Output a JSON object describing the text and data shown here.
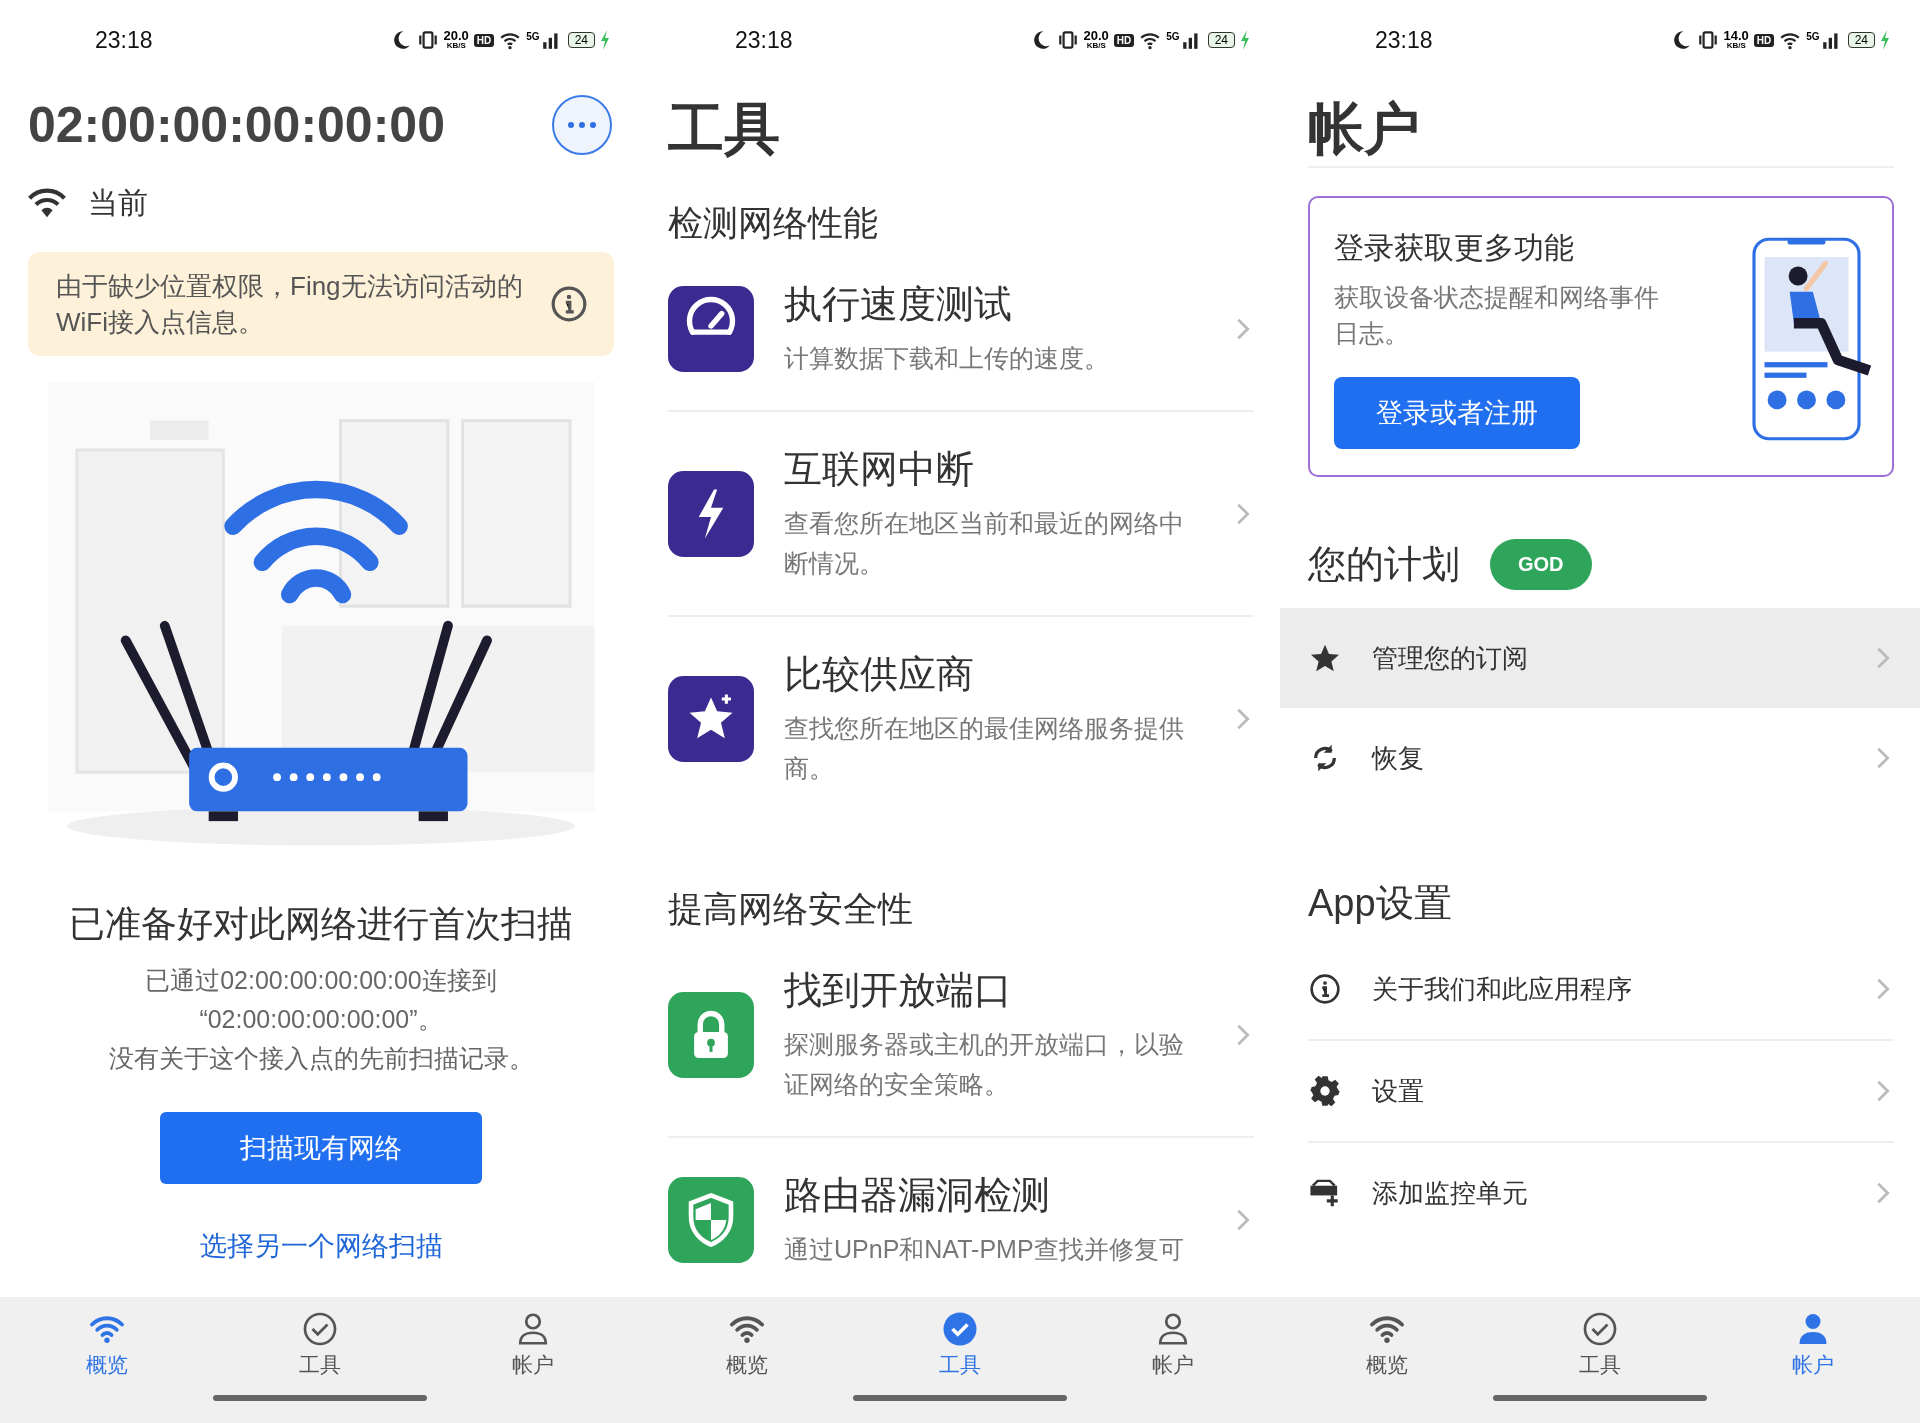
{
  "screens": [
    {
      "kind": "overview",
      "status_bar": {
        "time": "23:18",
        "speed": "20.0",
        "speed_unit": "KB/S",
        "hd": "HD",
        "network": "5G",
        "battery": "24"
      },
      "network_name": "02:00:00:00:00:00",
      "current_label": "当前",
      "warning": "由于缺少位置权限，Fing无法访问活动的WiFi接入点信息。",
      "heading": "已准备好对此网络进行首次扫描",
      "description": [
        "已通过02:00:00:00:00:00连接到",
        "“02:00:00:00:00:00”。",
        "没有关于这个接入点的先前扫描记录。"
      ],
      "scan_button": "扫描现有网络",
      "other_link": "选择另一个网络扫描",
      "tab_bar": [
        {
          "label": "概览",
          "kind": "wifi",
          "selected": true
        },
        {
          "label": "工具",
          "kind": "check",
          "selected": false
        },
        {
          "label": "帐户",
          "kind": "person",
          "selected": false
        }
      ]
    },
    {
      "kind": "tools",
      "status_bar": {
        "time": "23:18",
        "speed": "20.0",
        "speed_unit": "KB/S",
        "hd": "HD",
        "network": "5G",
        "battery": "24"
      },
      "title": "工具",
      "sections": [
        {
          "title": "检测网络性能",
          "items": [
            {
              "title": "执行速度测试",
              "description": "计算数据下载和上传的速度。",
              "kind": "gauge",
              "color": "#3b2a8f"
            },
            {
              "title": "互联网中断",
              "description": "查看您所在地区当前和最近的网络中断情况。",
              "kind": "bolt",
              "color": "#3b2a8f"
            },
            {
              "title": "比较供应商",
              "description": "查找您所在地区的最佳网络服务提供商。",
              "kind": "star",
              "color": "#3b2a8f"
            }
          ]
        },
        {
          "title": "提高网络安全性",
          "items": [
            {
              "title": "找到开放端口",
              "description": "探测服务器或主机的开放端口，以验证网络的安全策略。",
              "kind": "lock",
              "color": "#2fa55c"
            },
            {
              "title": "路由器漏洞检测",
              "description": "通过UPnP和NAT-PMP查找并修复可",
              "kind": "shield",
              "color": "#2fa55c"
            }
          ]
        }
      ],
      "tab_bar": [
        {
          "label": "概览",
          "kind": "wifi",
          "selected": false
        },
        {
          "label": "工具",
          "kind": "check",
          "selected": true
        },
        {
          "label": "帐户",
          "kind": "person",
          "selected": false
        }
      ]
    },
    {
      "kind": "account",
      "status_bar": {
        "time": "23:18",
        "speed": "14.0",
        "speed_unit": "KB/S",
        "hd": "HD",
        "network": "5G",
        "battery": "24"
      },
      "title": "帐户",
      "login_card": {
        "title": "登录获取更多功能",
        "description": "获取设备状态提醒和网络事件日志。",
        "button": "登录或者注册"
      },
      "plan": {
        "title": "您的计划",
        "badge": "GOD",
        "items": [
          {
            "label": "管理您的订阅",
            "kind": "star",
            "selected": true
          },
          {
            "label": "恢复",
            "kind": "refresh",
            "selected": false
          }
        ]
      },
      "app_settings": {
        "title": "App设置",
        "items": [
          {
            "label": "关于我们和此应用程序",
            "kind": "info"
          },
          {
            "label": "设置",
            "kind": "gear"
          },
          {
            "label": "添加监控单元",
            "kind": "router-add"
          }
        ]
      },
      "tab_bar": [
        {
          "label": "概览",
          "kind": "wifi",
          "selected": false
        },
        {
          "label": "工具",
          "kind": "check",
          "selected": false
        },
        {
          "label": "帐户",
          "kind": "person",
          "selected": true
        }
      ]
    }
  ]
}
